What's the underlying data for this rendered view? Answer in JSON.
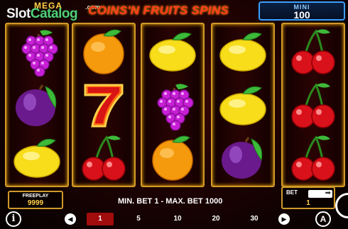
{
  "header": {
    "mega_label": "MEGA",
    "watermark_slot": "Slot",
    "watermark_catalog": "Catalog",
    "watermark_com": ".com",
    "title": "COINS'N FRUITS SPINS",
    "mini_label": "MINI",
    "mini_value": "100"
  },
  "reels": [
    {
      "symbols": [
        "grapes-icon",
        "plum-icon",
        "lemon-icon"
      ]
    },
    {
      "symbols": [
        "orange-icon",
        "seven-icon",
        "cherry-icon"
      ]
    },
    {
      "symbols": [
        "lemon-icon",
        "grapes-icon",
        "orange-icon"
      ]
    },
    {
      "symbols": [
        "lemon-icon",
        "lemon-icon",
        "plum-icon"
      ]
    },
    {
      "symbols": [
        "cherry-icon",
        "cherry-icon",
        "cherry-icon"
      ]
    }
  ],
  "freeplay": {
    "label": "FREEPLAY",
    "value": "9999"
  },
  "bet_info": "MIN. BET 1 - MAX. BET 1000",
  "bet": {
    "label": "BET",
    "value": "1"
  },
  "bet_options": [
    "1",
    "5",
    "10",
    "20",
    "30"
  ],
  "selected_bet": "1",
  "buttons": {
    "info": "i",
    "autoplay": "A",
    "prev": "◀",
    "next": "▶"
  },
  "colors": {
    "reel_border": "#d09a2a",
    "title": "#ff3b22",
    "mini_border": "#3aa0ff",
    "selected_bet": "#a10c0c"
  }
}
